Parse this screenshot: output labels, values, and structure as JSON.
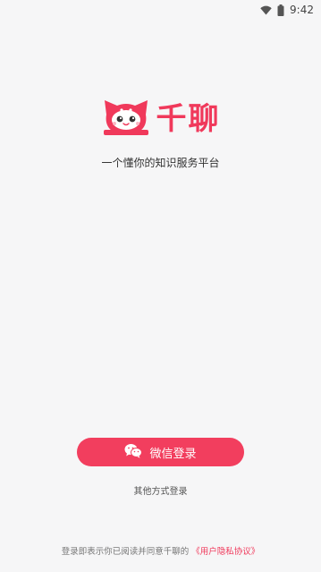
{
  "status_bar": {
    "time": "9:42",
    "wifi_icon": "wifi-icon",
    "battery_icon": "battery-icon"
  },
  "brand": {
    "name": "千聊",
    "logo_icon": "mascot-logo-icon",
    "color": "#f0395b"
  },
  "tagline": "一个懂你的知识服务平台",
  "login": {
    "wechat_label": "微信登录",
    "wechat_icon": "wechat-icon",
    "button_color": "#f23e5e",
    "other_label": "其他方式登录"
  },
  "agreement": {
    "prefix": "登录即表示你已阅读并同意千聊的",
    "link_text": "《用户隐私协议》"
  }
}
